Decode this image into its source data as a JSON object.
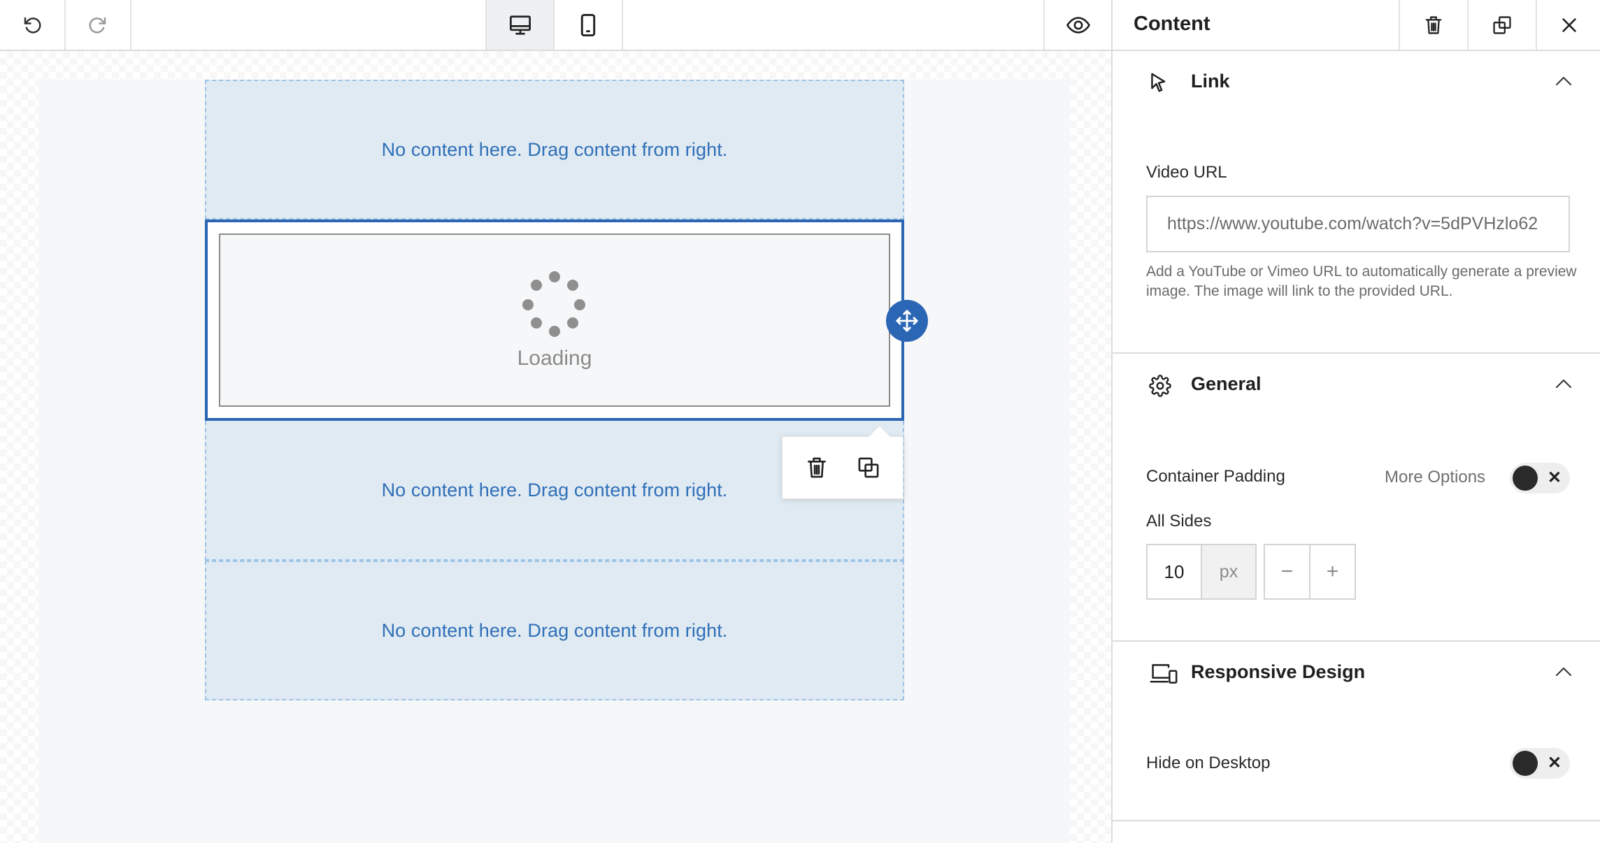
{
  "toolbar": {
    "undo_icon": "undo-icon",
    "redo_icon": "redo-icon",
    "desktop_icon": "desktop-icon",
    "mobile_icon": "mobile-icon",
    "preview_icon": "eye-icon"
  },
  "canvas": {
    "empty_text": "No content here. Drag content from right.",
    "loading_text": "Loading"
  },
  "panel": {
    "title": "Content",
    "sections": {
      "link": {
        "title": "Link",
        "video_url_label": "Video URL",
        "video_url_value": "https://www.youtube.com/watch?v=5dPVHzlo62",
        "help": "Add a YouTube or Vimeo URL to automatically generate a preview image. The image will link to the provided URL."
      },
      "general": {
        "title": "General",
        "container_padding_label": "Container Padding",
        "more_options_label": "More Options",
        "all_sides_label": "All Sides",
        "padding_value": "10",
        "padding_unit": "px",
        "minus": "−",
        "plus": "+"
      },
      "responsive": {
        "title": "Responsive Design",
        "hide_on_desktop_label": "Hide on Desktop"
      }
    }
  },
  "colors": {
    "accent": "#2a66b3",
    "dropzone_bg": "#e0eaf2",
    "dropzone_text": "#2f6fb8"
  }
}
